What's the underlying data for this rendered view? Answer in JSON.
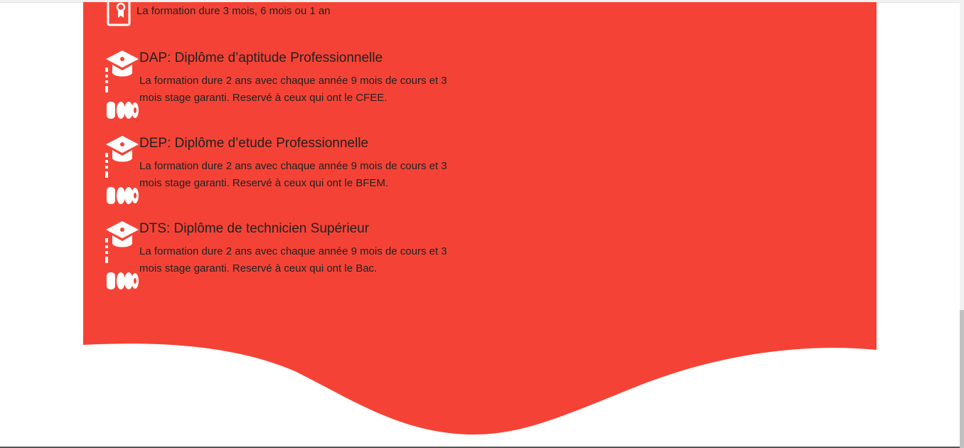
{
  "colors": {
    "panel_red": "#f44336",
    "text": "#222222",
    "icon": "#ffffff",
    "page_bg": "#ffffff"
  },
  "formations": {
    "first": {
      "icon": "diploma-scroll-icon",
      "text": "La formation dure 3 mois, 6 mois ou 1 an"
    },
    "items": [
      {
        "icon": "graduation-icon",
        "title": "DAP: Diplôme d’aptitude Professionnelle",
        "text": "La formation dure 2 ans avec chaque année 9 mois de cours et 3 mois stage garanti. Reservé à ceux qui ont le CFEE."
      },
      {
        "icon": "graduation-icon",
        "title": "DEP: Diplôme d’etude Professionnelle",
        "text": "La formation dure 2 ans avec chaque année 9 mois de cours et 3 mois stage garanti. Reservé à ceux qui ont le BFEM."
      },
      {
        "icon": "graduation-icon",
        "title": "DTS: Diplôme de technicien Supérieur",
        "text": "La formation dure 2 ans avec chaque année 9 mois de cours et 3 mois stage garanti. Reservé à ceux qui ont le Bac."
      }
    ]
  }
}
